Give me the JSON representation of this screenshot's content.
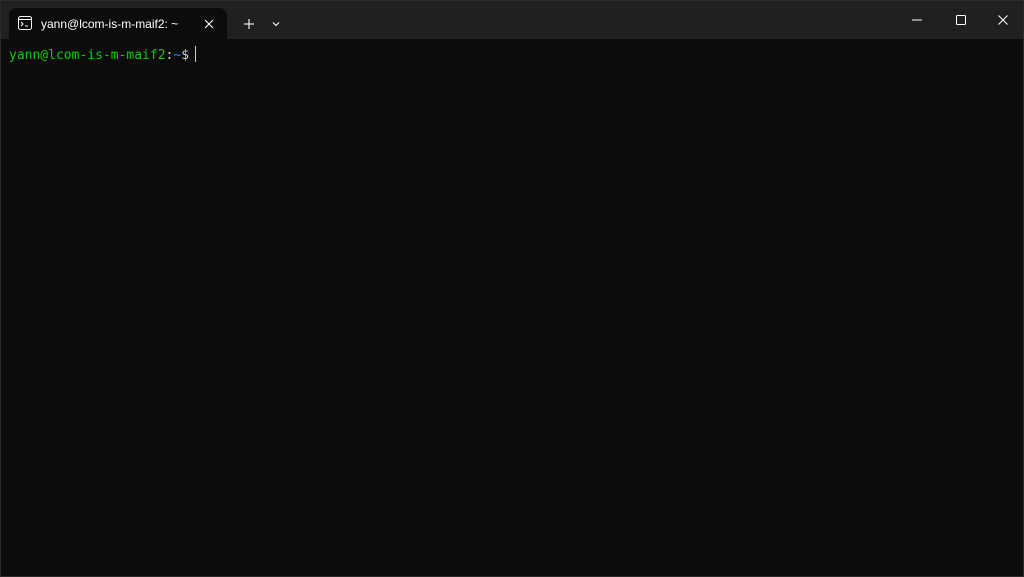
{
  "tab": {
    "title": "yann@lcom-is-m-maif2: ~",
    "icon": "terminal-icon"
  },
  "toolbar": {
    "new_tab_icon": "plus-icon",
    "dropdown_icon": "chevron-down-icon"
  },
  "window_controls": {
    "minimize_icon": "minimize-icon",
    "maximize_icon": "maximize-icon",
    "close_icon": "close-icon"
  },
  "terminal": {
    "prompt_user_host": "yann@lcom-is-m-maif2",
    "prompt_separator": ":",
    "prompt_path": "~",
    "prompt_symbol": "$"
  },
  "colors": {
    "background": "#0c0c0c",
    "titlebar": "#202020",
    "user_host": "#16c60c",
    "path": "#3b78ff",
    "text": "#cccccc"
  }
}
